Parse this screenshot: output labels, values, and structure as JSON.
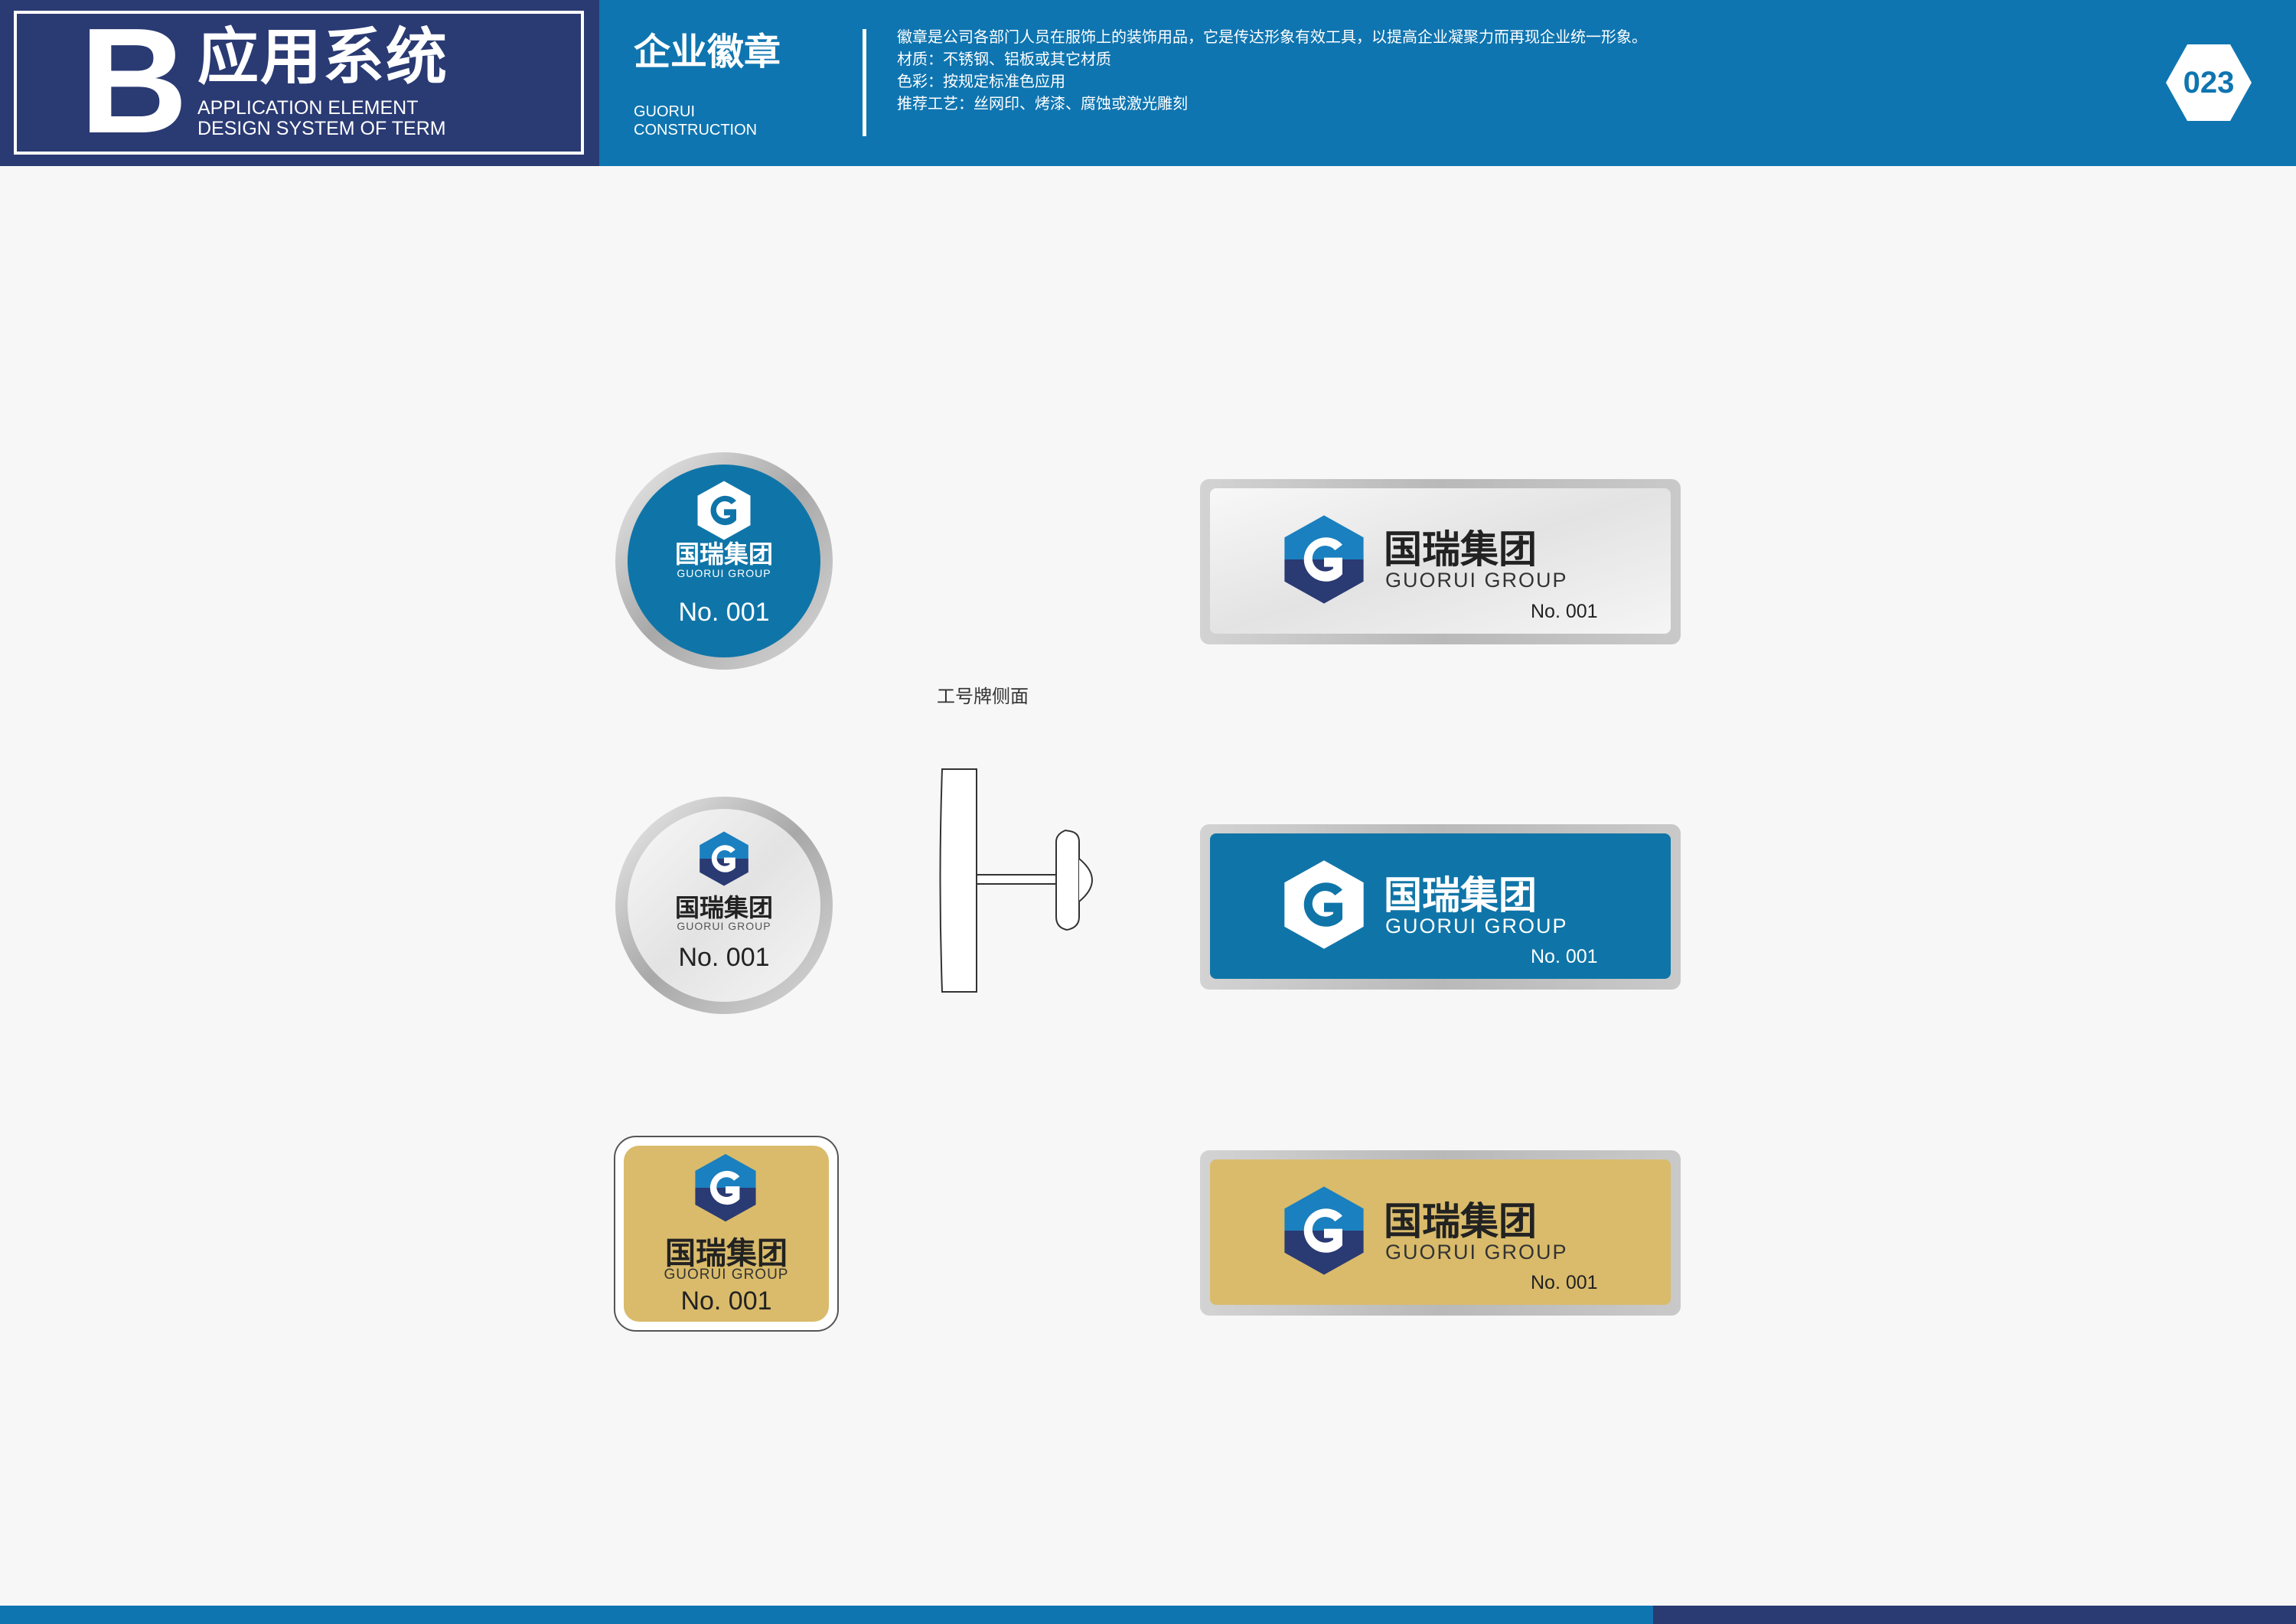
{
  "header": {
    "letter": "B",
    "system_title": "应用系统",
    "system_en_line1": "APPLICATION ELEMENT",
    "system_en_line2": "DESIGN SYSTEM OF TERM",
    "section_title": "企业徽章",
    "section_en_line1": "GUORUI",
    "section_en_line2": "CONSTRUCTION",
    "description": [
      "徽章是公司各部门人员在服饰上的装饰用品，它是传达形象有效工具，以提高企业凝聚力而再现企业统一形象。",
      "材质：不锈钢、铝板或其它材质",
      "色彩：按规定标准色应用",
      "推荐工艺：丝网印、烤漆、腐蚀或激光雕刻"
    ],
    "page_number": "023"
  },
  "brand": {
    "cn": "国瑞集团",
    "en": "GUORUI GROUP",
    "badge_no": "No. 001"
  },
  "side_view_label": "工号牌侧面",
  "colors": {
    "primary_blue": "#0f75b0",
    "navy": "#2a3a73",
    "gold": "#d9bb6b",
    "silver": "#c8c8c8"
  }
}
